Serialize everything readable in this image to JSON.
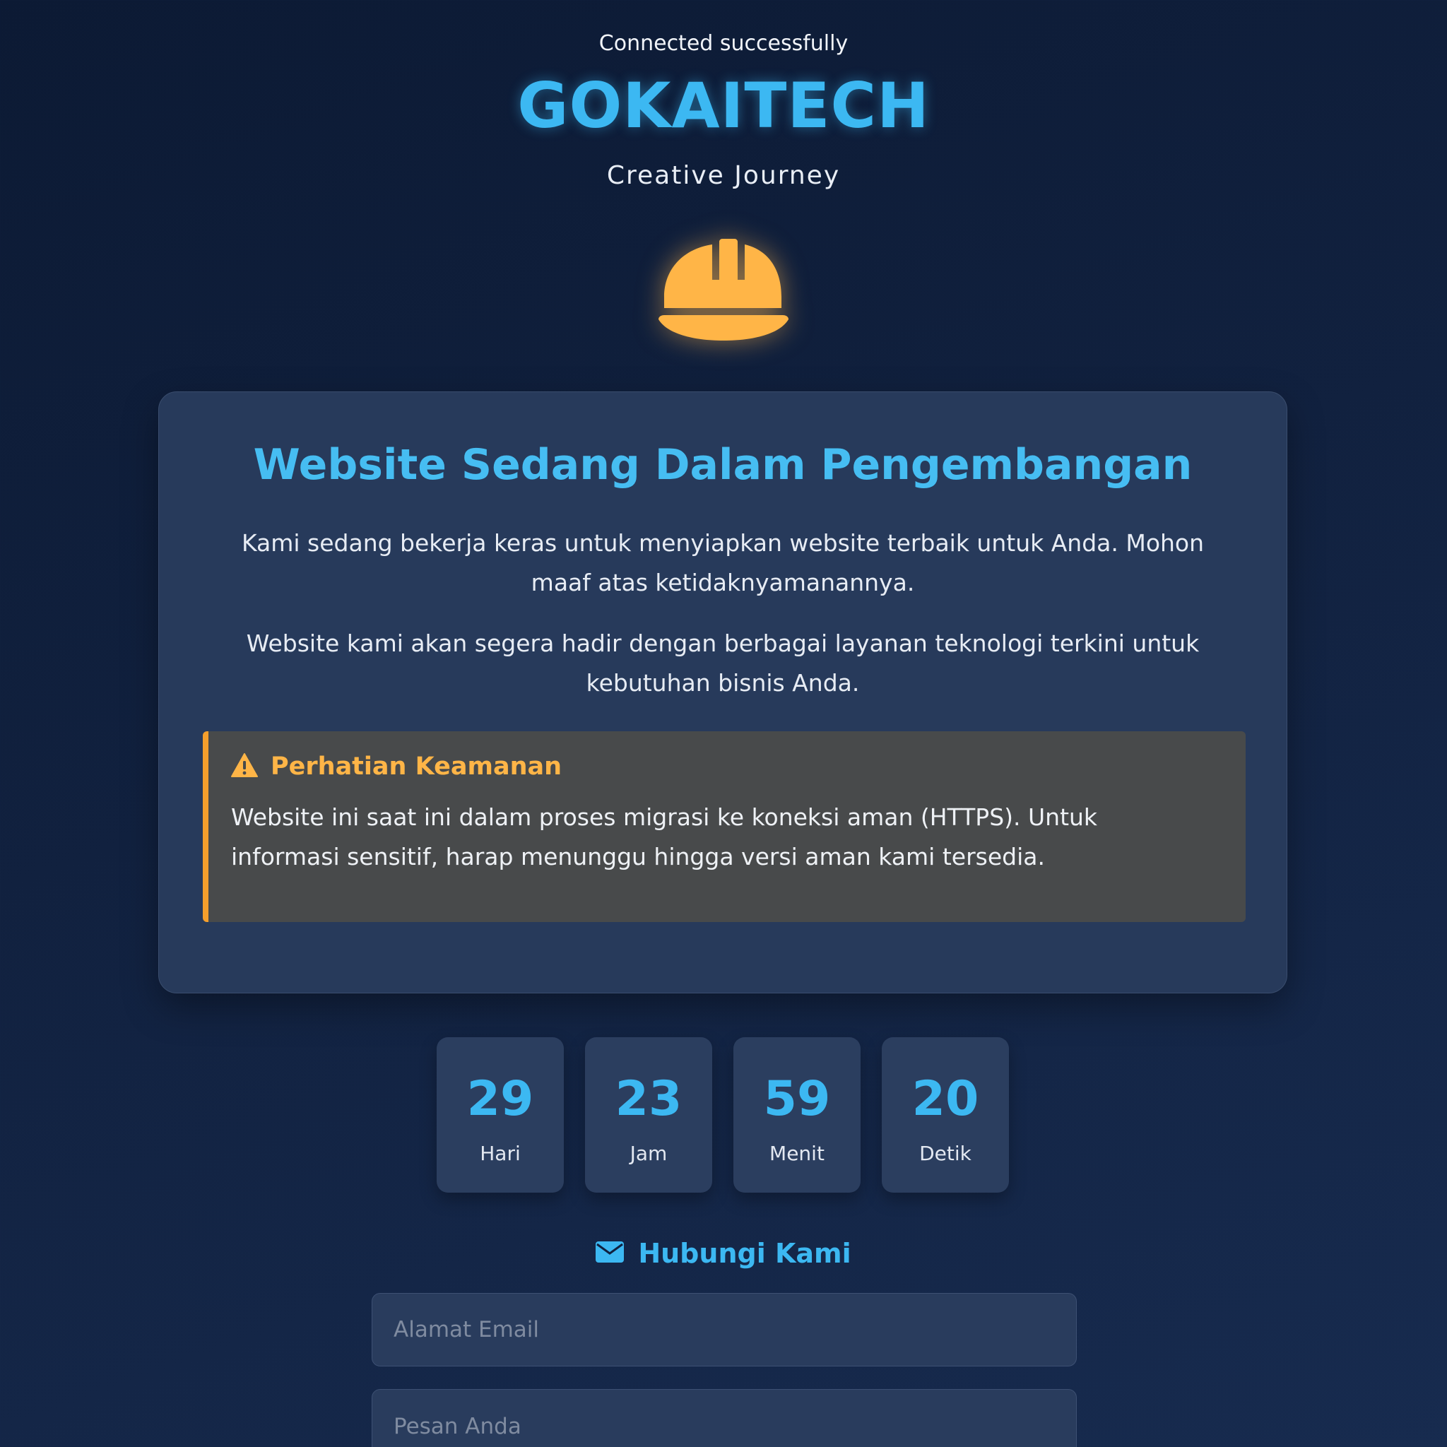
{
  "header": {
    "status": "Connected successfully",
    "brand": "GOKAITECH",
    "tagline": "Creative Journey"
  },
  "icons": {
    "hero": "helmet-icon",
    "notice": "warning-icon",
    "contact": "envelope-icon"
  },
  "colors": {
    "accent": "#3cb8f2",
    "warning": "#ffb547",
    "background": "#11213f",
    "card": "#273a5b"
  },
  "card": {
    "title": "Website Sedang Dalam Pengembangan",
    "paragraph1": "Kami sedang bekerja keras untuk menyiapkan website terbaik untuk Anda. Mohon maaf atas ketidaknyamanannya.",
    "paragraph2": "Website kami akan segera hadir dengan berbagai layanan teknologi terkini untuk kebutuhan bisnis Anda.",
    "notice": {
      "title": "Perhatian Keamanan",
      "body": "Website ini saat ini dalam proses migrasi ke koneksi aman (HTTPS). Untuk informasi sensitif, harap menunggu hingga versi aman kami tersedia."
    }
  },
  "countdown": [
    {
      "value": "29",
      "label": "Hari"
    },
    {
      "value": "23",
      "label": "Jam"
    },
    {
      "value": "59",
      "label": "Menit"
    },
    {
      "value": "20",
      "label": "Detik"
    }
  ],
  "contact": {
    "title": "Hubungi Kami",
    "email_placeholder": "Alamat Email",
    "email_value": "",
    "message_placeholder": "Pesan Anda",
    "message_value": ""
  }
}
